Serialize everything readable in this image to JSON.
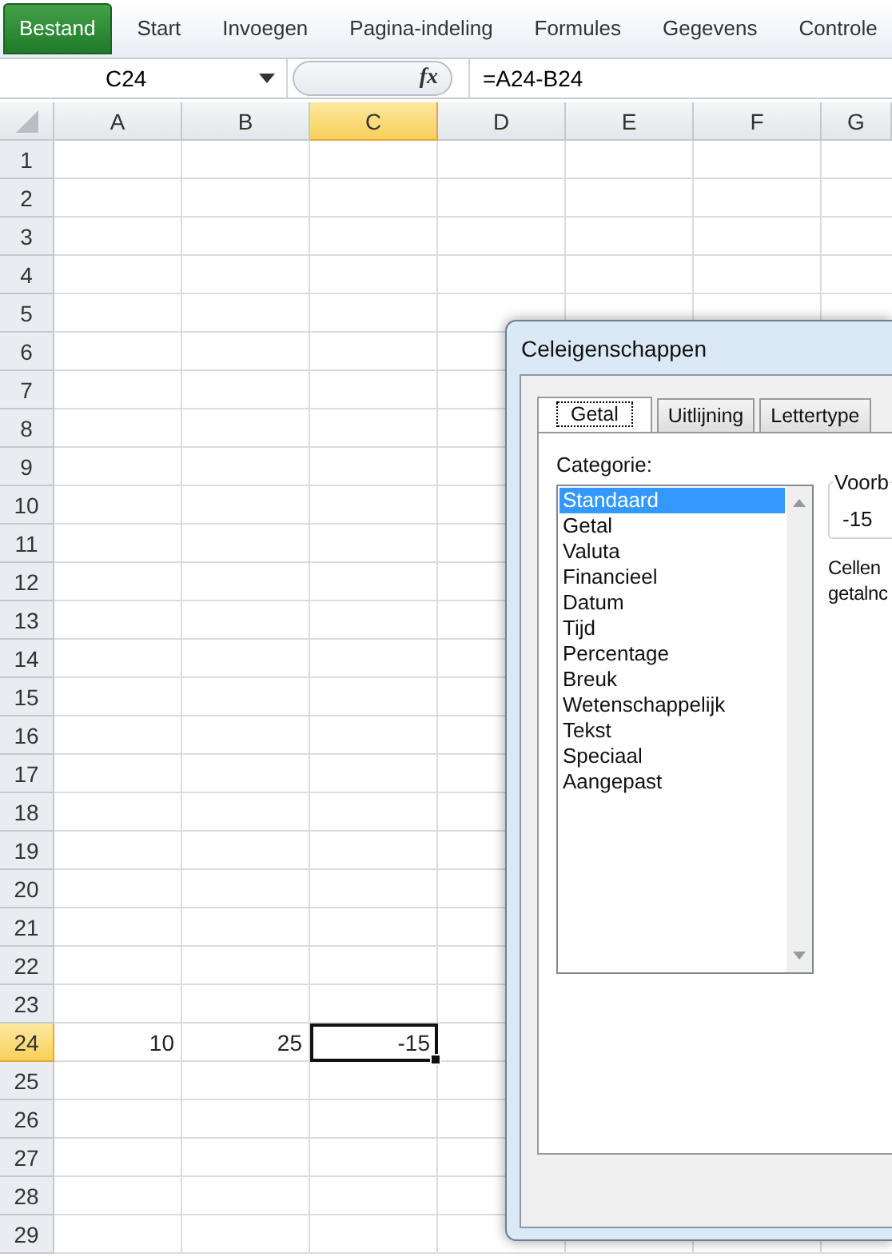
{
  "ribbon": {
    "tabs": [
      {
        "label": "Bestand",
        "kind": "file",
        "selected": false
      },
      {
        "label": "Start",
        "kind": "tab",
        "selected": false
      },
      {
        "label": "Invoegen",
        "kind": "tab",
        "selected": false
      },
      {
        "label": "Pagina-indeling",
        "kind": "tab",
        "selected": false
      },
      {
        "label": "Formules",
        "kind": "tab",
        "selected": false
      },
      {
        "label": "Gegevens",
        "kind": "tab",
        "selected": false
      },
      {
        "label": "Controle",
        "kind": "tab",
        "selected": false
      }
    ]
  },
  "formula_bar": {
    "name_box": "C24",
    "function_button": "fx",
    "formula": "=A24-B24"
  },
  "sheet": {
    "columns": [
      {
        "label": "A",
        "selected": false
      },
      {
        "label": "B",
        "selected": false
      },
      {
        "label": "C",
        "selected": true
      },
      {
        "label": "D",
        "selected": false
      },
      {
        "label": "E",
        "selected": false
      },
      {
        "label": "F",
        "selected": false
      },
      {
        "label": "G",
        "selected": false
      }
    ],
    "rows": [
      {
        "label": "1",
        "selected": false
      },
      {
        "label": "2",
        "selected": false
      },
      {
        "label": "3",
        "selected": false
      },
      {
        "label": "4",
        "selected": false
      },
      {
        "label": "5",
        "selected": false
      },
      {
        "label": "6",
        "selected": false
      },
      {
        "label": "7",
        "selected": false
      },
      {
        "label": "8",
        "selected": false
      },
      {
        "label": "9",
        "selected": false
      },
      {
        "label": "10",
        "selected": false
      },
      {
        "label": "11",
        "selected": false
      },
      {
        "label": "12",
        "selected": false
      },
      {
        "label": "13",
        "selected": false
      },
      {
        "label": "14",
        "selected": false
      },
      {
        "label": "15",
        "selected": false
      },
      {
        "label": "16",
        "selected": false
      },
      {
        "label": "17",
        "selected": false
      },
      {
        "label": "18",
        "selected": false
      },
      {
        "label": "19",
        "selected": false
      },
      {
        "label": "20",
        "selected": false
      },
      {
        "label": "21",
        "selected": false
      },
      {
        "label": "22",
        "selected": false
      },
      {
        "label": "23",
        "selected": false
      },
      {
        "label": "24",
        "selected": true,
        "cells": [
          {
            "text": "10",
            "active": false
          },
          {
            "text": "25",
            "active": false
          },
          {
            "text": "-15",
            "active": true
          }
        ]
      },
      {
        "label": "25",
        "selected": false
      },
      {
        "label": "26",
        "selected": false
      },
      {
        "label": "27",
        "selected": false
      },
      {
        "label": "28",
        "selected": false
      },
      {
        "label": "29",
        "selected": false
      }
    ]
  },
  "dialog": {
    "title": "Celeigenschappen",
    "tabs": [
      {
        "label": "Getal",
        "selected": true
      },
      {
        "label": "Uitlijning",
        "selected": false
      },
      {
        "label": "Lettertype",
        "selected": false
      }
    ],
    "category_label": "Categorie:",
    "categories": [
      {
        "label": "Standaard",
        "selected": true
      },
      {
        "label": "Getal",
        "selected": false
      },
      {
        "label": "Valuta",
        "selected": false
      },
      {
        "label": "Financieel",
        "selected": false
      },
      {
        "label": "Datum",
        "selected": false
      },
      {
        "label": "Tijd",
        "selected": false
      },
      {
        "label": "Percentage",
        "selected": false
      },
      {
        "label": "Breuk",
        "selected": false
      },
      {
        "label": "Wetenschappelijk",
        "selected": false
      },
      {
        "label": "Tekst",
        "selected": false
      },
      {
        "label": "Speciaal",
        "selected": false
      },
      {
        "label": "Aangepast",
        "selected": false
      }
    ],
    "sample": {
      "legend": "Voorb",
      "value": "-15"
    },
    "description": [
      "Cellen",
      "getalnc"
    ]
  }
}
